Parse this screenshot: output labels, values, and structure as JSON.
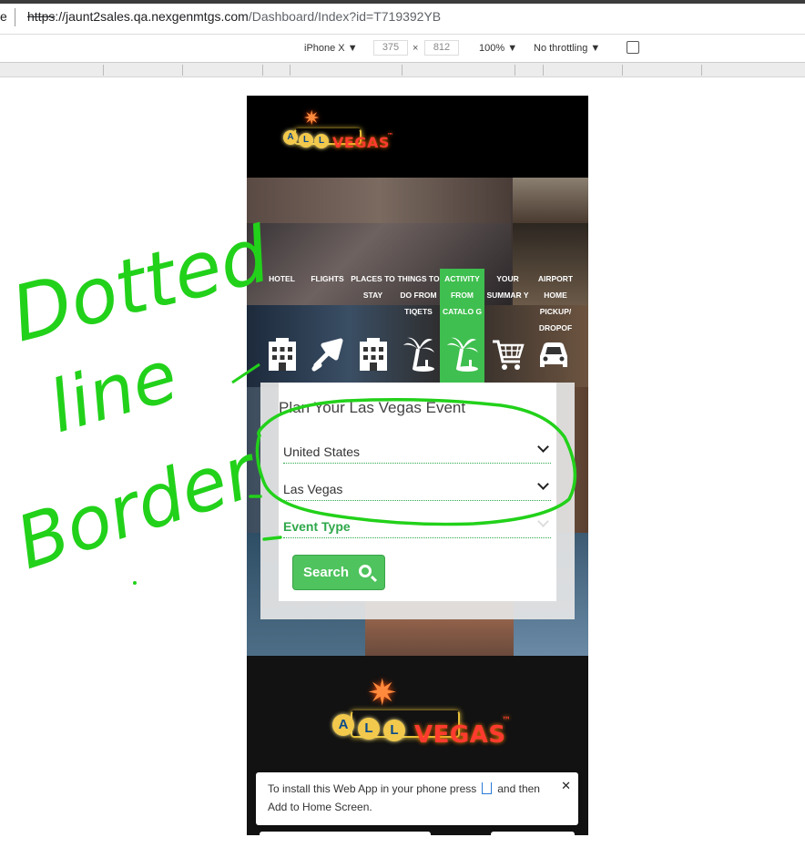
{
  "browser": {
    "tab_fragment": "e",
    "url_protocol": "https",
    "url_host": "://jaunt2sales.qa.nexgenmtgs.com",
    "url_path": "/Dashboard/Index?id=T719392YB"
  },
  "devtools": {
    "device": "iPhone X ▼",
    "width": "375",
    "height": "812",
    "times": "×",
    "zoom": "100% ▼",
    "throttling": "No throttling ▼"
  },
  "logo": {
    "letters": [
      "A",
      "L",
      "L"
    ],
    "brand": "VEGAS",
    "tm": "™"
  },
  "nav": {
    "items": [
      {
        "label": "HOTEL",
        "icon": "hotel-icon",
        "active": false
      },
      {
        "label": "FLIGHTS",
        "icon": "plane-icon",
        "active": false
      },
      {
        "label": "PLACES TO STAY",
        "icon": "hotel-icon",
        "active": false
      },
      {
        "label": "THINGS TO DO FROM TIQETS",
        "icon": "palm-tree-icon",
        "active": false
      },
      {
        "label": "ACTIVITY FROM CATALO G",
        "icon": "palm-tree-icon",
        "active": true
      },
      {
        "label": "YOUR SUMMAR Y",
        "icon": "cart-icon",
        "active": false
      },
      {
        "label": "AIRPORT HOME PICKUP/ DROPOF",
        "icon": "car-icon",
        "active": false
      }
    ],
    "active_color": "#3fbf4f"
  },
  "form": {
    "title": "Plan Your Las Vegas Event",
    "country": "United States",
    "city": "Las Vegas",
    "event_type": "Event Type",
    "search_label": "Search",
    "accent": "#2ea84a"
  },
  "toast": {
    "text_before": "To install this Web App in your phone press",
    "text_after": "and then Add to Home Screen.",
    "close": "✕"
  },
  "annotation": {
    "line1": "Dotted",
    "line2": "line",
    "line3": "Border",
    "color": "#22d11a"
  }
}
